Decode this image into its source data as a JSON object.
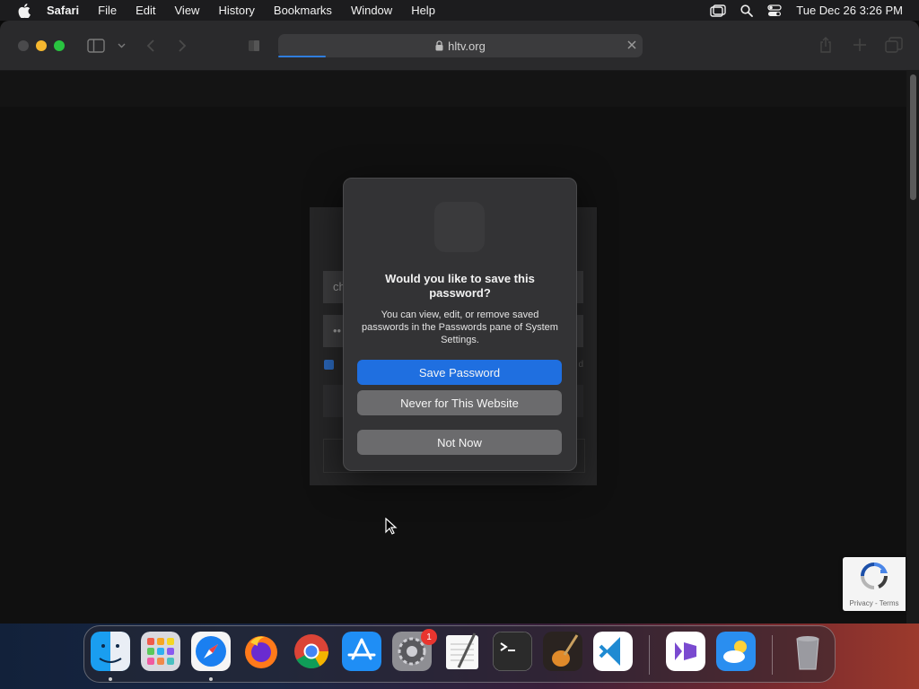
{
  "menubar": {
    "items": [
      "Safari",
      "File",
      "Edit",
      "View",
      "History",
      "Bookmarks",
      "Window",
      "Help"
    ],
    "datetime": "Tue Dec 26  3:26 PM"
  },
  "browser": {
    "url": "hltv.org",
    "load_progress": 0.13
  },
  "login_form": {
    "username_value": "ch",
    "password_value": "••"
  },
  "password_dialog": {
    "title": "Would you like to save this password?",
    "body": "You can view, edit, or remove saved passwords in the Passwords pane of System Settings.",
    "save_label": "Save Password",
    "never_label": "Never for This Website",
    "not_now_label": "Not Now"
  },
  "recaptcha": {
    "text": "Privacy - Terms"
  },
  "dock": {
    "apps": [
      "finder",
      "launchpad",
      "safari",
      "firefox",
      "chrome",
      "app-store",
      "system-settings",
      "textedit",
      "terminal",
      "garageband",
      "vscode",
      "visual-studio",
      "weather",
      "trash"
    ],
    "settings_badge": "1"
  },
  "colors": {
    "accent": "#1f6fe0",
    "dialog_bg": "#333335",
    "close_red": "#4a4a4c",
    "minimize_yellow": "#f5b72f",
    "maximize_green": "#29c440",
    "badge_red": "#e9352f"
  }
}
